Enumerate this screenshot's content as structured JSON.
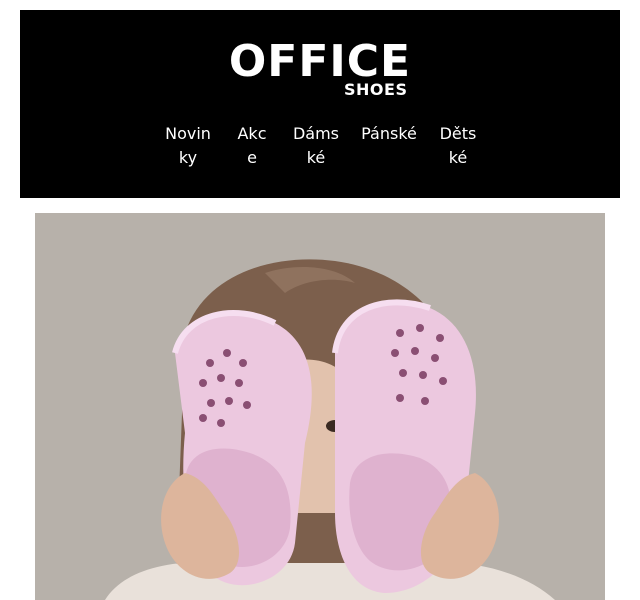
{
  "brand": {
    "logo_main": "OFFICE",
    "logo_sub": "SHOES"
  },
  "nav": {
    "items": [
      {
        "label": "Novinky"
      },
      {
        "label": "Akce"
      },
      {
        "label": "Dámské"
      },
      {
        "label": "Pánské"
      },
      {
        "label": "Dětské"
      }
    ]
  },
  "hero": {
    "image": "girl-holding-pink-clogs-photo"
  },
  "colors": {
    "header_bg": "#000000",
    "header_text": "#ffffff",
    "hero_bg": "#b5afa8",
    "clog_pink": "#eac5de"
  }
}
